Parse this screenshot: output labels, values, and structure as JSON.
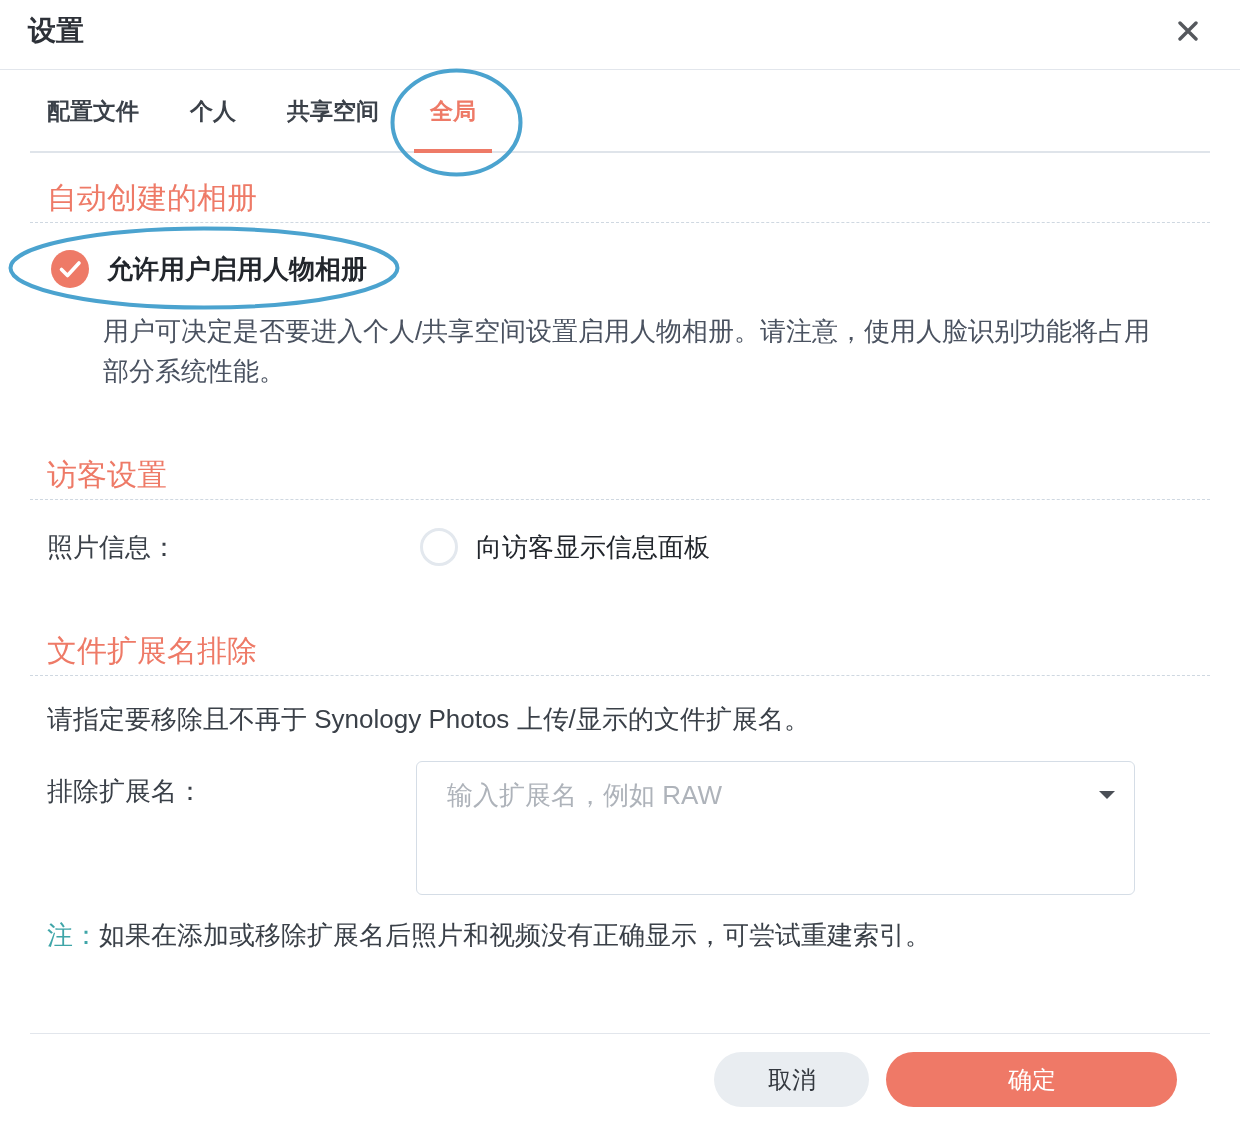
{
  "dialog": {
    "title": "设置"
  },
  "tabs": [
    {
      "label": "配置文件",
      "selected": false,
      "highlighted": false
    },
    {
      "label": "个人",
      "selected": false,
      "highlighted": false
    },
    {
      "label": "共享空间",
      "selected": false,
      "highlighted": false
    },
    {
      "label": "全局",
      "selected": true,
      "highlighted": true
    }
  ],
  "sections": [
    {
      "title": "自动创建的相册",
      "items": [
        {
          "kind": "checkbox",
          "label": "允许用户启用人物相册",
          "checked": true,
          "highlighted": true,
          "description": "用户可决定是否要进入个人/共享空间设置启用人物相册。请注意，使用人脸识别功能将占用部分系统性能。"
        }
      ]
    },
    {
      "title": "访客设置",
      "items": [
        {
          "kind": "radio",
          "label": "照片信息：",
          "option": "向访客显示信息面板",
          "checked": false
        }
      ]
    },
    {
      "title": "文件扩展名排除",
      "items": [
        {
          "kind": "text",
          "text": "请指定要移除且不再于 Synology Photos 上传/显示的文件扩展名。"
        },
        {
          "kind": "select",
          "label": "排除扩展名：",
          "placeholder": "输入扩展名，例如 RAW"
        },
        {
          "kind": "note",
          "label": "注：",
          "text": "如果在添加或移除扩展名后照片和视频没有正确显示，可尝试重建索引。"
        }
      ]
    }
  ],
  "buttons": [
    {
      "label": "取消",
      "kind": "secondary"
    },
    {
      "label": "确定",
      "kind": "primary"
    }
  ]
}
